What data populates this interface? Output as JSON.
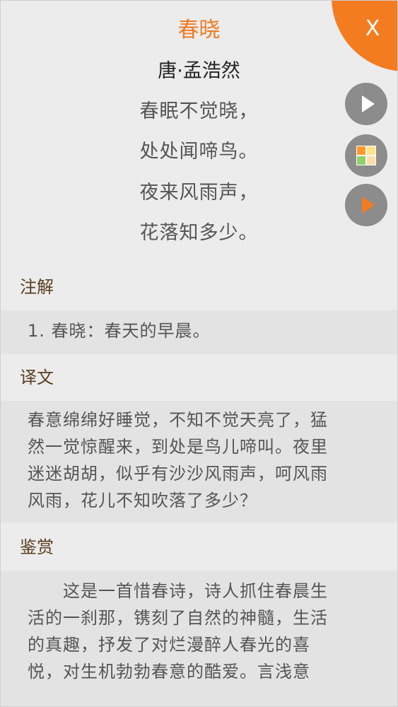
{
  "poem": {
    "title": "春晓",
    "author": "唐·孟浩然",
    "lines": [
      "春眠不觉晓，",
      "处处闻啼鸟。",
      "夜来风雨声，",
      "花落知多少。"
    ]
  },
  "controls": {
    "close_label": "X"
  },
  "sections": {
    "notes": {
      "heading": "注解",
      "items": [
        "1. 春晓：春天的早晨。"
      ]
    },
    "translation": {
      "heading": "译文",
      "lines": [
        "春意绵绵好睡觉，不知不觉天亮了，猛",
        "然一觉惊醒来，到处是鸟儿啼叫。夜里",
        "迷迷胡胡，似乎有沙沙风雨声，呵风雨",
        "风雨，花儿不知吹落了多少？"
      ]
    },
    "appreciation": {
      "heading": "鉴赏",
      "lines": [
        "　　这是一首惜春诗，诗人抓住春晨生",
        "活的一刹那，镌刻了自然的神髓，生活",
        "的真趣，抒发了对烂漫醉人春光的喜",
        "悦，对生机勃勃春意的酷爱。言浅意"
      ]
    }
  },
  "colors": {
    "accent": "#f47c20",
    "title": "#f07a22",
    "heading": "#5a3e1f",
    "button": "#8c8c8c"
  },
  "icons": [
    "close-icon",
    "play-icon",
    "grid-icon",
    "play-orange-icon"
  ]
}
